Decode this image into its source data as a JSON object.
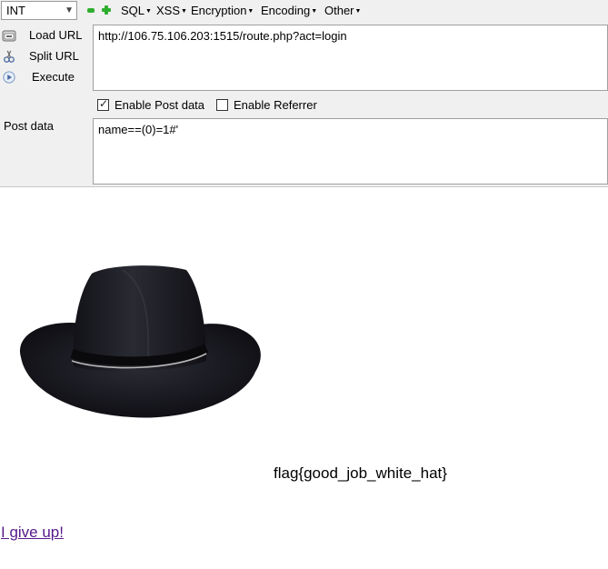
{
  "hackbar": {
    "select_value": "INT",
    "menus": [
      {
        "label": "SQL"
      },
      {
        "label": "XSS"
      },
      {
        "label": "Encryption"
      },
      {
        "label": "Encoding"
      },
      {
        "label": "Other"
      }
    ],
    "side_buttons": {
      "load_url": "Load URL",
      "split_url": "Split URL",
      "execute": "Execute"
    },
    "url": "http://106.75.106.203:1515/route.php?act=login",
    "enable_post_data": {
      "label": "Enable Post data",
      "checked": true
    },
    "enable_referrer": {
      "label": "Enable Referrer",
      "checked": false
    },
    "post_label": "Post data",
    "post_data": "name==(0)=1#'"
  },
  "page": {
    "flag": "flag{good_job_white_hat}",
    "give_up_link": "I give up!"
  },
  "colors": {
    "link": "#551a8b",
    "hackbar_bg": "#f0f0f0",
    "plus_minus_green": "#2eae2e"
  }
}
